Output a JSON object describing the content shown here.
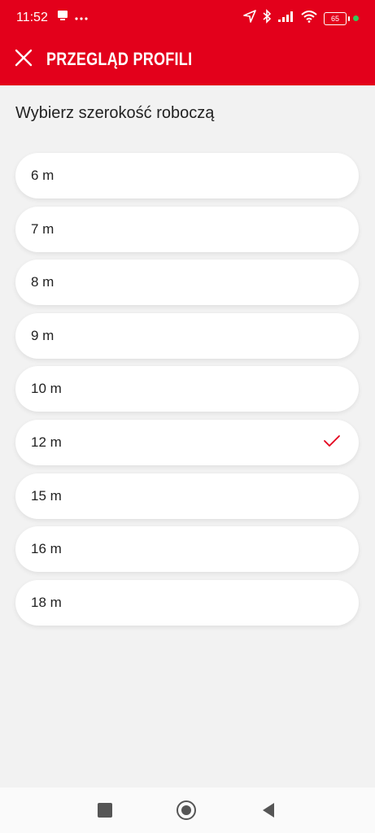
{
  "status_bar": {
    "time": "11:52",
    "battery": "65",
    "icons": [
      "notification-icon",
      "more-dots-icon",
      "location-arrow-icon",
      "bluetooth-icon",
      "signal-icon",
      "wifi-icon",
      "battery-icon"
    ]
  },
  "appbar": {
    "title": "PRZEGLĄD PROFILI",
    "close_icon": "close-icon"
  },
  "section": {
    "title": "Wybierz szerokość roboczą"
  },
  "options": [
    {
      "label": "6 m",
      "selected": false
    },
    {
      "label": "7 m",
      "selected": false
    },
    {
      "label": "8 m",
      "selected": false
    },
    {
      "label": "9 m",
      "selected": false
    },
    {
      "label": "10 m",
      "selected": false
    },
    {
      "label": "12 m",
      "selected": true
    },
    {
      "label": "15 m",
      "selected": false
    },
    {
      "label": "16 m",
      "selected": false
    },
    {
      "label": "18 m",
      "selected": false
    }
  ],
  "nav": {
    "icons": [
      "recents-square-icon",
      "home-circle-icon",
      "back-triangle-icon"
    ]
  },
  "colors": {
    "brand_red": "#e3001b",
    "background": "#f2f2f2",
    "check": "#e3001b"
  }
}
